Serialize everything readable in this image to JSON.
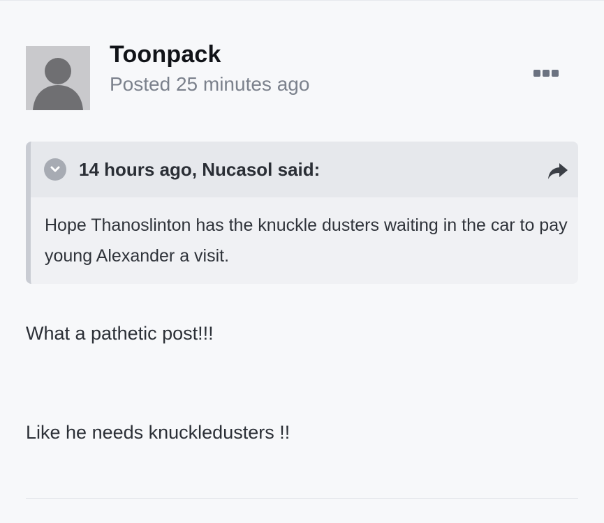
{
  "post": {
    "author": "Toonpack",
    "posted_time": "Posted 25 minutes ago",
    "avatar_icon": "default-user-avatar-icon",
    "more_icon": "ellipsis-menu-icon",
    "quote": {
      "citation": "14 hours ago, Nucasol said:",
      "toggle_icon": "chevron-down-circle-icon",
      "share_icon": "share-arrow-icon",
      "text": "Hope Thanoslinton has the knuckle dusters waiting in the car to pay young Alexander a visit."
    },
    "body": [
      "What a pathetic post!!!",
      "Like he needs knuckledusters !!"
    ]
  },
  "colors": {
    "page_background": "#f7f8fa",
    "quote_header_background": "#e6e8ec",
    "quote_background": "#f0f1f4",
    "quote_border": "#c9ccd3",
    "meta_text": "#7b818c"
  }
}
